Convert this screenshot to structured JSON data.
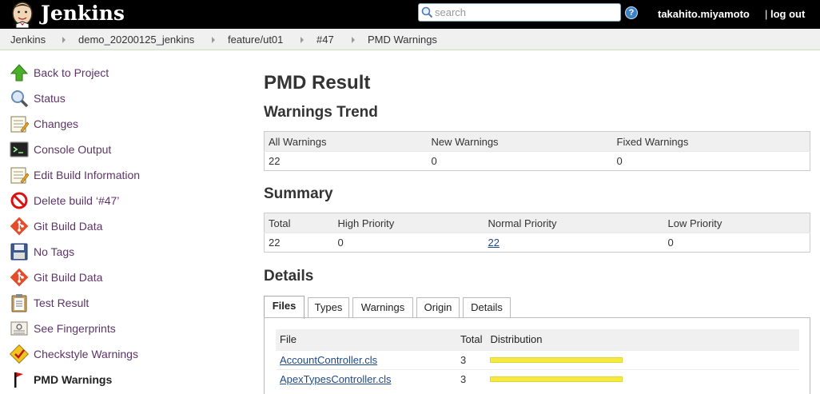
{
  "header": {
    "brand": "Jenkins",
    "search_placeholder": "search",
    "user": "takahito.miyamoto",
    "logout_sep": "|",
    "logout": "log out",
    "help_glyph": "?"
  },
  "breadcrumb": [
    "Jenkins",
    "demo_20200125_jenkins",
    "feature/ut01",
    "#47",
    "PMD Warnings"
  ],
  "sidebar": {
    "items": [
      {
        "label": "Back to Project",
        "icon": "up-arrow-icon"
      },
      {
        "label": "Status",
        "icon": "magnifier-icon"
      },
      {
        "label": "Changes",
        "icon": "notepad-icon"
      },
      {
        "label": "Console Output",
        "icon": "terminal-icon"
      },
      {
        "label": "Edit Build Information",
        "icon": "notepad-edit-icon"
      },
      {
        "label": "Delete build ‘#47’",
        "icon": "no-entry-icon"
      },
      {
        "label": "Git Build Data",
        "icon": "git-icon"
      },
      {
        "label": "No Tags",
        "icon": "floppy-disk-icon"
      },
      {
        "label": "Git Build Data",
        "icon": "git-icon"
      },
      {
        "label": "Test Result",
        "icon": "clipboard-icon"
      },
      {
        "label": "See Fingerprints",
        "icon": "fingerprint-icon"
      },
      {
        "label": "Checkstyle Warnings",
        "icon": "checkstyle-icon"
      },
      {
        "label": "PMD Warnings",
        "icon": "pmd-flag-icon"
      }
    ]
  },
  "main": {
    "title": "PMD Result",
    "trend": {
      "heading": "Warnings Trend",
      "headers": [
        "All Warnings",
        "New Warnings",
        "Fixed Warnings"
      ],
      "values": [
        "22",
        "0",
        "0"
      ]
    },
    "summary": {
      "heading": "Summary",
      "headers": [
        "Total",
        "High Priority",
        "Normal Priority",
        "Low Priority"
      ],
      "values": [
        "22",
        "0",
        "22",
        "0"
      ]
    },
    "details": {
      "heading": "Details",
      "tabs": [
        "Files",
        "Types",
        "Warnings",
        "Origin",
        "Details"
      ],
      "active_tab": "Files",
      "files_headers": [
        "File",
        "Total",
        "Distribution"
      ],
      "files": [
        {
          "name": "AccountController.cls",
          "total": "3",
          "distribution_fraction": 1.0
        },
        {
          "name": "ApexTypesController.cls",
          "total": "3",
          "distribution_fraction": 1.0
        }
      ]
    }
  },
  "colors": {
    "header_bg": "#000000",
    "link": "#5c3566",
    "distribution_bar": "#f5e942"
  }
}
